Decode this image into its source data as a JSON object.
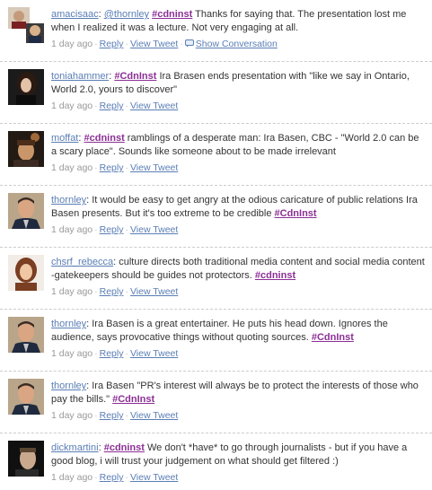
{
  "colors": {
    "link": "#5a7eb5",
    "hashtag": "#8b2f95",
    "text": "#333333",
    "meta": "#999999"
  },
  "tweets": [
    {
      "user": "amacisaac",
      "mention": "@thornley",
      "hashtag": "#cdninst",
      "text": " Thanks for saying that. The presentation lost me when I realized it was a lecture. Not very engaging at all.",
      "time": "1 day ago",
      "reply": "Reply",
      "view": "View Tweet",
      "convo": "Show Conversation"
    },
    {
      "user": "toniahammer",
      "hashtag": "#CdnInst",
      "text": " Ira Brasen ends presentation with \"like we say in Ontario, World 2.0, yours to discover\"",
      "time": "1 day ago",
      "reply": "Reply",
      "view": "View Tweet"
    },
    {
      "user": "moffat",
      "hashtag": "#cdninst",
      "text": " ramblings of a desperate man: Ira Basen, CBC - \"World 2.0 can be a scary place\". Sounds like someone about to be made irrelevant",
      "time": "1 day ago",
      "reply": "Reply",
      "view": "View Tweet"
    },
    {
      "user": "thornley",
      "text": ": It would be easy to get angry at the odious caricature of public relations Ira Basen presents. But it's too extreme to be credible ",
      "hashtag": "#CdnInst",
      "time": "1 day ago",
      "reply": "Reply",
      "view": "View Tweet"
    },
    {
      "user": "chsrf_rebecca",
      "text": ": culture directs both traditional media content and social media content -gatekeepers should be guides not protectors. ",
      "hashtag": "#cdninst",
      "time": "1 day ago",
      "reply": "Reply",
      "view": "View Tweet"
    },
    {
      "user": "thornley",
      "text": ": Ira Basen is a great entertainer. He puts his head down. Ignores the audience, says provocative things without quoting sources. ",
      "hashtag": "#CdnInst",
      "time": "1 day ago",
      "reply": "Reply",
      "view": "View Tweet"
    },
    {
      "user": "thornley",
      "text": ": Ira Basen \"PR's interest will always be to protect the interests of those who pay the bills.\" ",
      "hashtag": "#CdnInst",
      "time": "1 day ago",
      "reply": "Reply",
      "view": "View Tweet"
    },
    {
      "user": "dickmartini",
      "hashtag": "#cdninst",
      "text": " We don't *have* to go through journalists - but if you have a good blog, i will trust your judgement on what should get filtered :)",
      "time": "1 day ago",
      "reply": "Reply",
      "view": "View Tweet"
    }
  ]
}
